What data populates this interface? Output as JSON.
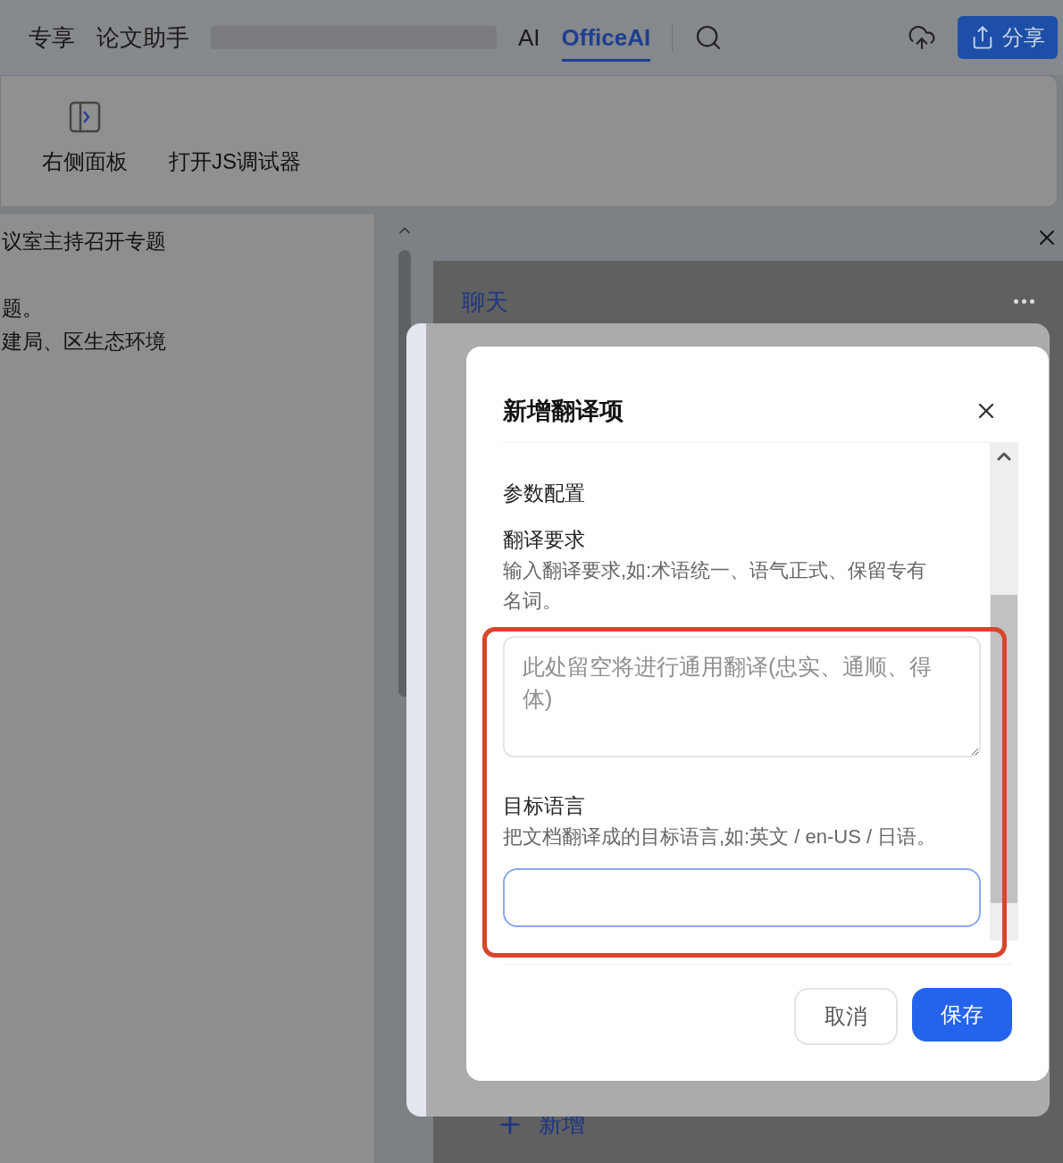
{
  "tabs": [
    {
      "label": "专享",
      "selected": false
    },
    {
      "label": "论文助手",
      "selected": false
    },
    {
      "label": "AI",
      "selected": false
    },
    {
      "label": "OfficeAI",
      "selected": true
    }
  ],
  "share_button": "分享",
  "ribbon": {
    "buttons": [
      "右侧面板",
      "打开JS调试器"
    ]
  },
  "document": {
    "paragraphs": [
      [
        "议室主持召开专题"
      ],
      [
        "题。",
        "建局、区生态环境"
      ]
    ]
  },
  "side_panel": {
    "tab": "聊天",
    "add_button": "新增"
  },
  "dialog": {
    "title": "新增翻译项",
    "section": "参数配置",
    "fields": [
      {
        "kind": "textarea",
        "label": "翻译要求",
        "help": "输入翻译要求,如:术语统一、语气正式、保留专有名词。",
        "placeholder": "此处留空将进行通用翻译(忠实、通顺、得体)",
        "focused": false
      },
      {
        "kind": "input",
        "label": "目标语言",
        "help": "把文档翻译成的目标语言,如:英文 / en-US / 日语。",
        "focused": true
      }
    ],
    "buttons": [
      {
        "label": "取消",
        "primary": false
      },
      {
        "label": "保存",
        "primary": true
      }
    ]
  }
}
